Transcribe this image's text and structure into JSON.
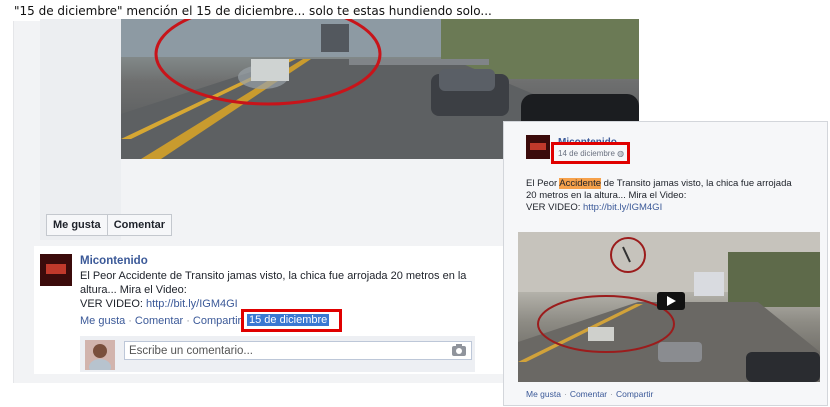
{
  "caption": "\"15 de diciembre\" mención el 15 de diciembre... solo te estas hundiendo solo...",
  "left_post": {
    "buttons": {
      "like": "Me gusta",
      "comment": "Comentar"
    },
    "page_name": "Micontenido",
    "text_line1": "El Peor Accidente de Transito jamas visto, la chica fue arrojada 20 metros en la",
    "text_line2": "altura... Mira el Video:",
    "text_line3_prefix": "VER VIDEO: ",
    "link": "http://bit.ly/IGM4GI",
    "actions": {
      "like": "Me gusta",
      "comment": "Comentar",
      "share": "Compartir"
    },
    "timestamp": "15 de diciembre",
    "comment_placeholder": "Escribe un comentario..."
  },
  "right_post": {
    "page_name": "Micontenido",
    "date": "14 de diciembre",
    "text_before": "El Peor ",
    "text_highlight": "Accidente",
    "text_after": " de Transito jamas visto, la chica fue arrojada",
    "text_line2": "20 metros en la altura... Mira el Video:",
    "text_line3_prefix": "VER VIDEO: ",
    "link": "http://bit.ly/IGM4GI",
    "actions": {
      "like": "Me gusta",
      "comment": "Comentar",
      "share": "Compartir"
    }
  },
  "colors": {
    "annotation_red": "#e00000",
    "link_blue": "#3b5998",
    "highlight_orange": "#f6a14b",
    "selection_blue": "#3a78d2"
  },
  "icons": [
    "camera-icon",
    "globe-icon",
    "play-icon"
  ]
}
